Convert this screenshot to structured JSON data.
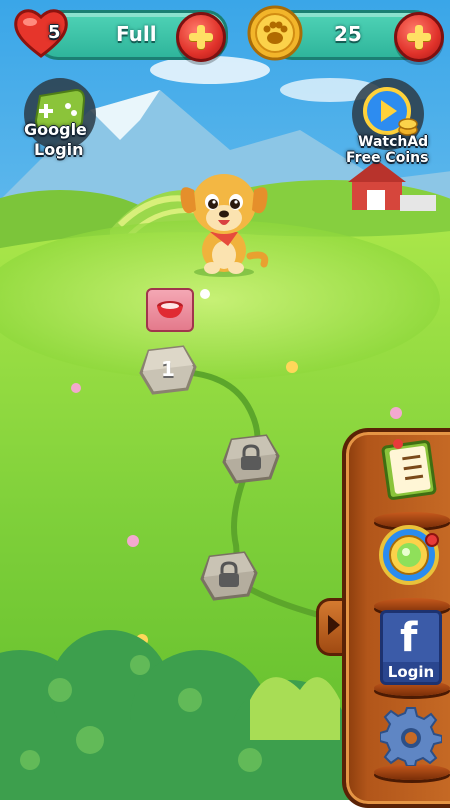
{
  "hud": {
    "lives": "5",
    "lives_status": "Full",
    "coins": "25"
  },
  "buttons": {
    "google_login": "Google\nLogin",
    "google_line1": "Google",
    "google_line2": "Login",
    "watch_ad_line1": "WatchAd",
    "watch_ad_line2": "Free Coins"
  },
  "map": {
    "level_1": "1"
  },
  "side_menu": {
    "facebook_letter": "f",
    "facebook_label": "Login"
  },
  "colors": {
    "hud_bar": "#2fb59b",
    "plus_button": "#e0322a",
    "side_panel": "#b2561a"
  },
  "icons": [
    "heart-icon",
    "paw-coin-icon",
    "gamepad-icon",
    "play-video-icon",
    "checklist-icon",
    "gem-orb-icon",
    "facebook-icon",
    "gear-icon",
    "lock-icon",
    "dog-bowl-icon"
  ]
}
